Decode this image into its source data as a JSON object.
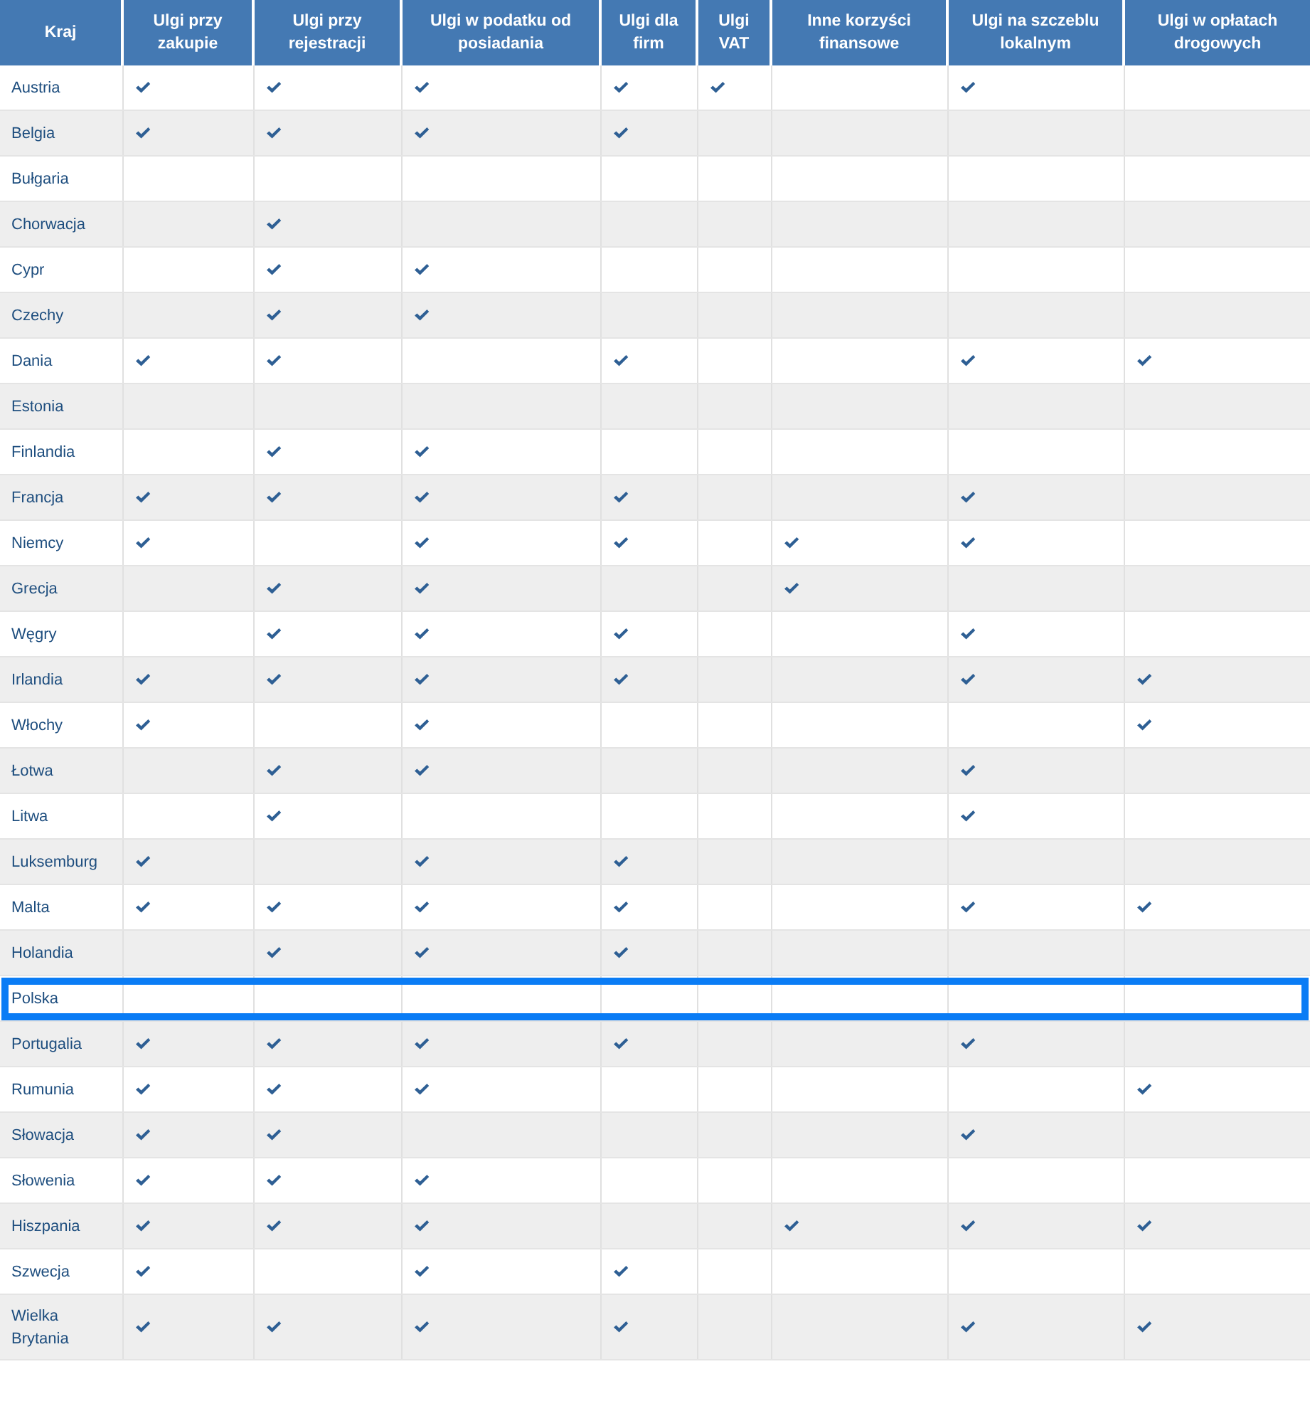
{
  "table": {
    "columns": [
      "Kraj",
      "Ulgi przy zakupie",
      "Ulgi przy rejestracji",
      "Ulgi w podatku od posiadania",
      "Ulgi dla firm",
      "Ulgi VAT",
      "Inne korzyści finansowe",
      "Ulgi na szczeblu lokalnym",
      "Ulgi w opłatach drogowych"
    ],
    "rows": [
      {
        "country": "Austria",
        "selected": false,
        "checks": [
          true,
          true,
          true,
          true,
          true,
          false,
          true,
          false
        ]
      },
      {
        "country": "Belgia",
        "selected": false,
        "checks": [
          true,
          true,
          true,
          true,
          false,
          false,
          false,
          false
        ]
      },
      {
        "country": "Bułgaria",
        "selected": false,
        "checks": [
          false,
          false,
          false,
          false,
          false,
          false,
          false,
          false
        ]
      },
      {
        "country": "Chorwacja",
        "selected": false,
        "checks": [
          false,
          true,
          false,
          false,
          false,
          false,
          false,
          false
        ]
      },
      {
        "country": "Cypr",
        "selected": false,
        "checks": [
          false,
          true,
          true,
          false,
          false,
          false,
          false,
          false
        ]
      },
      {
        "country": "Czechy",
        "selected": false,
        "checks": [
          false,
          true,
          true,
          false,
          false,
          false,
          false,
          false
        ]
      },
      {
        "country": "Dania",
        "selected": false,
        "checks": [
          true,
          true,
          false,
          true,
          false,
          false,
          true,
          true
        ]
      },
      {
        "country": "Estonia",
        "selected": false,
        "checks": [
          false,
          false,
          false,
          false,
          false,
          false,
          false,
          false
        ]
      },
      {
        "country": "Finlandia",
        "selected": false,
        "checks": [
          false,
          true,
          true,
          false,
          false,
          false,
          false,
          false
        ]
      },
      {
        "country": "Francja",
        "selected": false,
        "checks": [
          true,
          true,
          true,
          true,
          false,
          false,
          true,
          false
        ]
      },
      {
        "country": "Niemcy",
        "selected": false,
        "checks": [
          true,
          false,
          true,
          true,
          false,
          true,
          true,
          false
        ]
      },
      {
        "country": "Grecja",
        "selected": false,
        "checks": [
          false,
          true,
          true,
          false,
          false,
          true,
          false,
          false
        ]
      },
      {
        "country": "Węgry",
        "selected": false,
        "checks": [
          false,
          true,
          true,
          true,
          false,
          false,
          true,
          false
        ]
      },
      {
        "country": "Irlandia",
        "selected": false,
        "checks": [
          true,
          true,
          true,
          true,
          false,
          false,
          true,
          true
        ]
      },
      {
        "country": "Włochy",
        "selected": false,
        "checks": [
          true,
          false,
          true,
          false,
          false,
          false,
          false,
          true
        ]
      },
      {
        "country": "Łotwa",
        "selected": false,
        "checks": [
          false,
          true,
          true,
          false,
          false,
          false,
          true,
          false
        ]
      },
      {
        "country": "Litwa",
        "selected": false,
        "checks": [
          false,
          true,
          false,
          false,
          false,
          false,
          true,
          false
        ]
      },
      {
        "country": "Luksemburg",
        "selected": false,
        "checks": [
          true,
          false,
          true,
          true,
          false,
          false,
          false,
          false
        ]
      },
      {
        "country": "Malta",
        "selected": false,
        "checks": [
          true,
          true,
          true,
          true,
          false,
          false,
          true,
          true
        ]
      },
      {
        "country": "Holandia",
        "selected": false,
        "checks": [
          false,
          true,
          true,
          true,
          false,
          false,
          false,
          false
        ]
      },
      {
        "country": "Polska",
        "selected": true,
        "checks": [
          false,
          false,
          false,
          false,
          false,
          false,
          false,
          false
        ]
      },
      {
        "country": "Portugalia",
        "selected": false,
        "checks": [
          true,
          true,
          true,
          true,
          false,
          false,
          true,
          false
        ]
      },
      {
        "country": "Rumunia",
        "selected": false,
        "checks": [
          true,
          true,
          true,
          false,
          false,
          false,
          false,
          true
        ]
      },
      {
        "country": "Słowacja",
        "selected": false,
        "checks": [
          true,
          true,
          false,
          false,
          false,
          false,
          true,
          false
        ]
      },
      {
        "country": "Słowenia",
        "selected": false,
        "checks": [
          true,
          true,
          true,
          false,
          false,
          false,
          false,
          false
        ]
      },
      {
        "country": "Hiszpania",
        "selected": false,
        "checks": [
          true,
          true,
          true,
          false,
          false,
          true,
          true,
          true
        ]
      },
      {
        "country": "Szwecja",
        "selected": false,
        "checks": [
          true,
          false,
          true,
          true,
          false,
          false,
          false,
          false
        ]
      },
      {
        "country": "Wielka Brytania",
        "selected": false,
        "checks": [
          true,
          true,
          true,
          true,
          false,
          false,
          true,
          true
        ]
      }
    ]
  }
}
